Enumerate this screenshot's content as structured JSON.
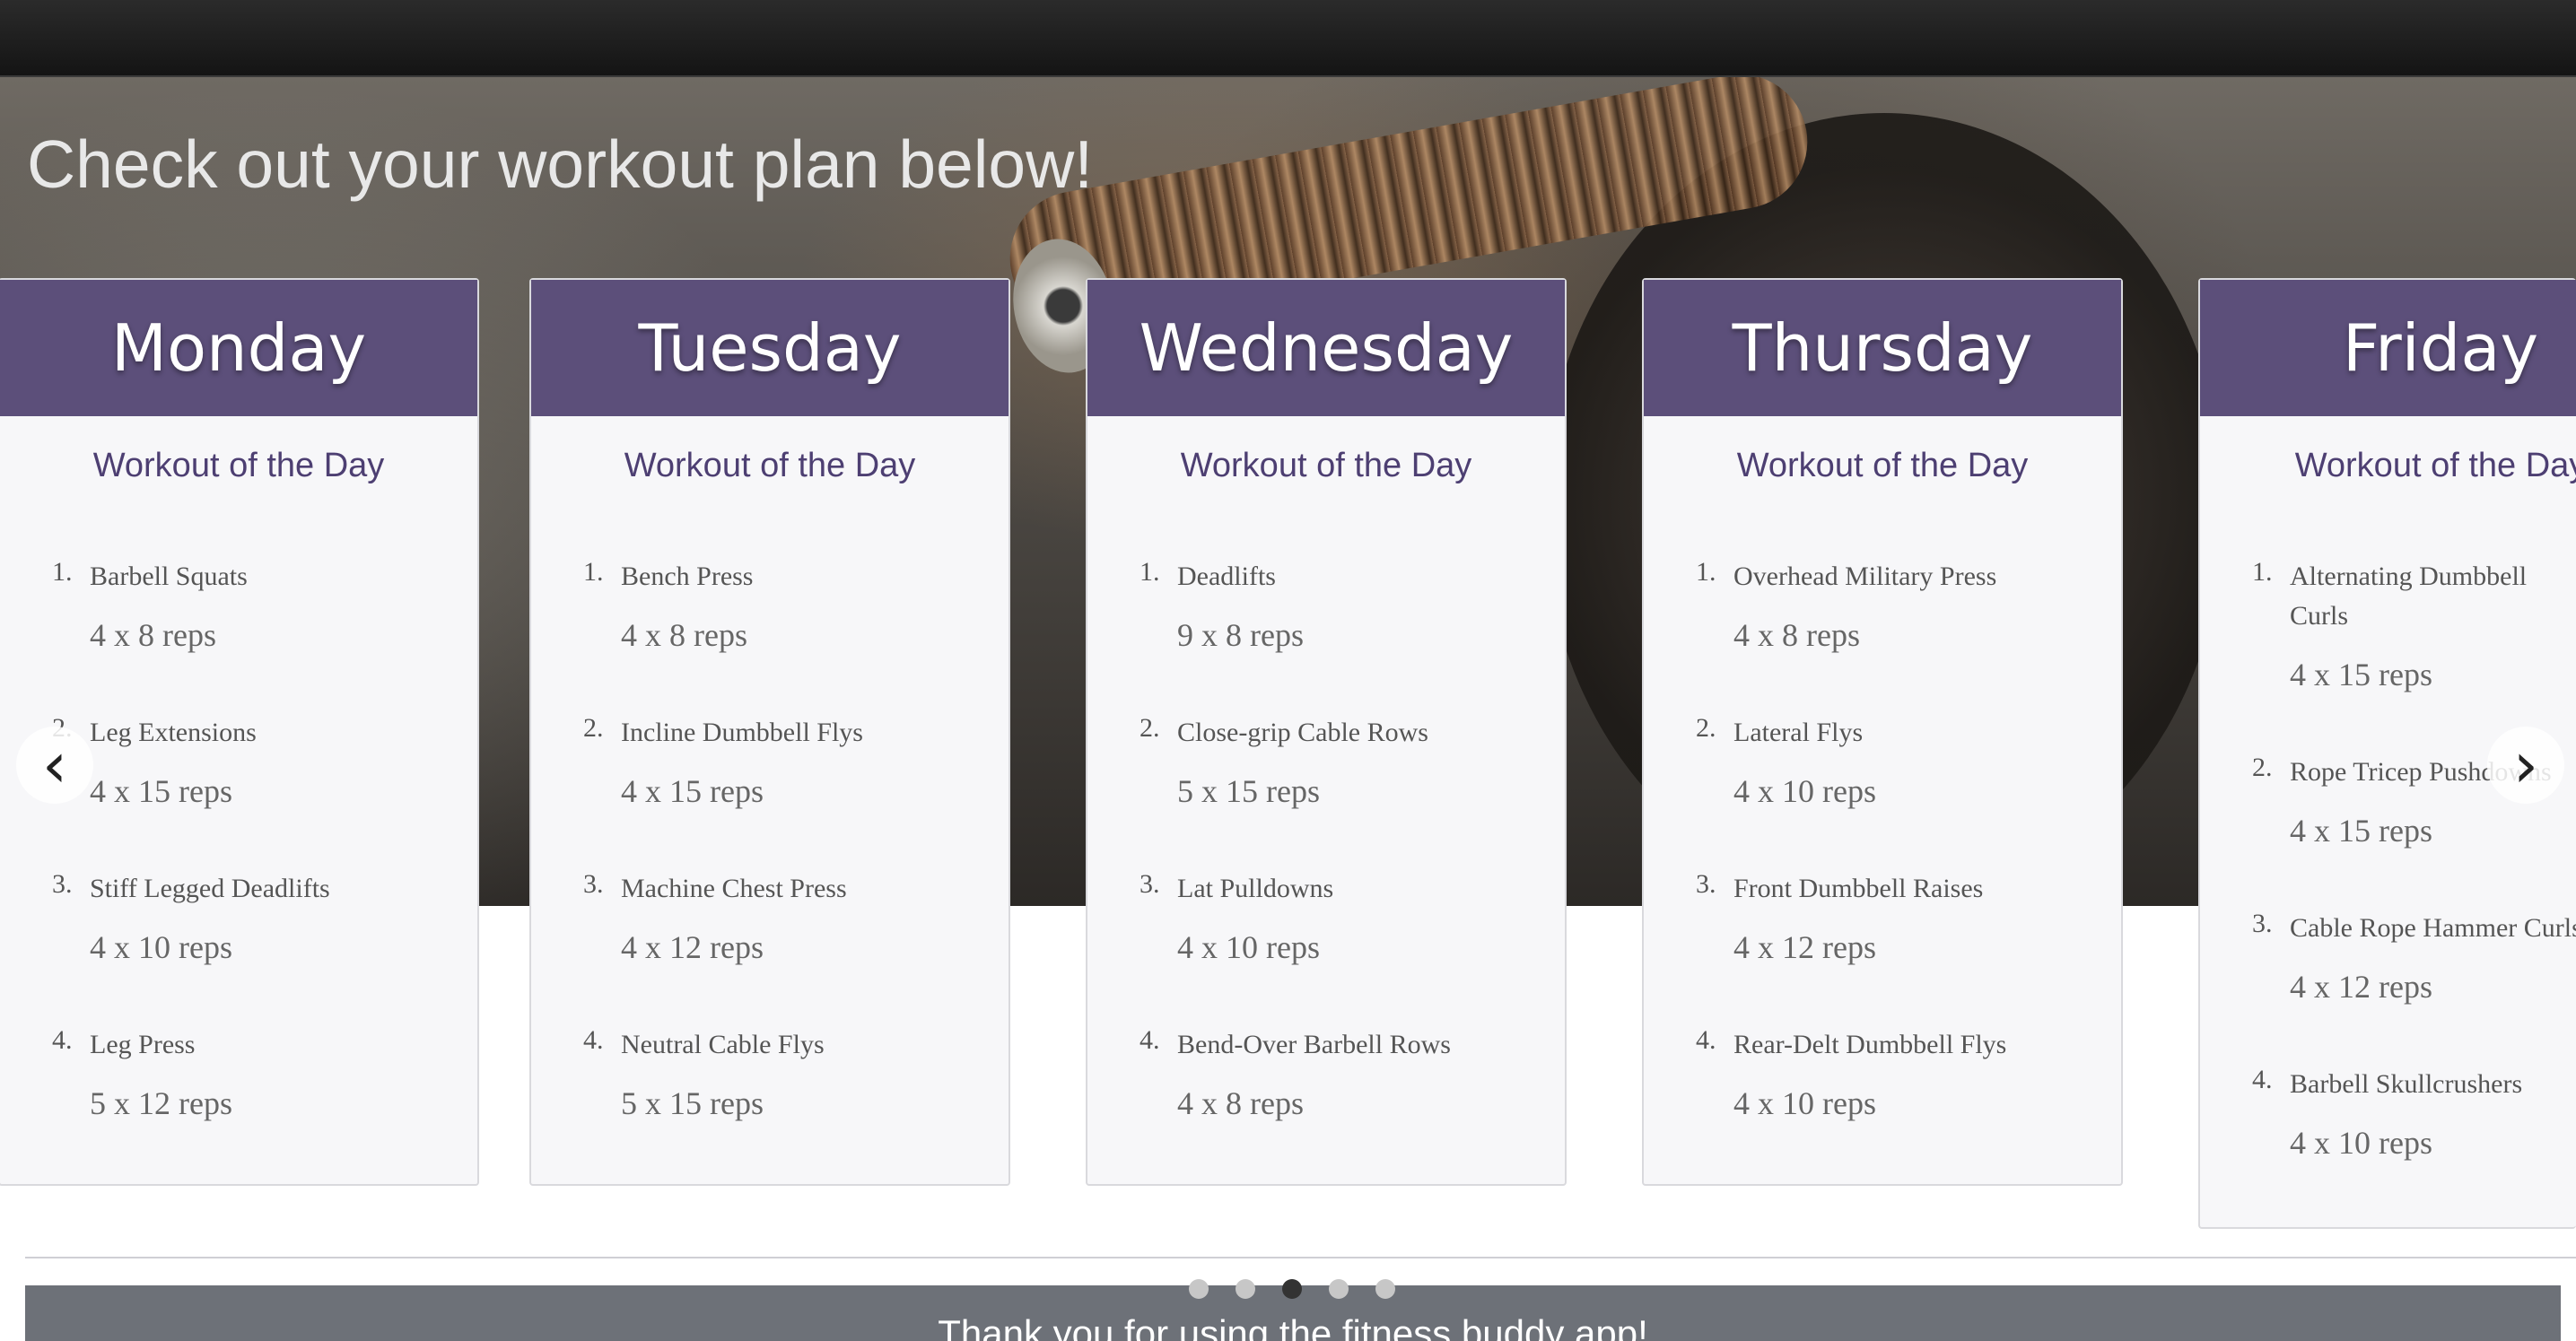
{
  "hero": {
    "title": "Check out your workout plan below!"
  },
  "cards": [
    {
      "day": "Monday",
      "subtitle": "Workout of the Day",
      "exercises": [
        {
          "num": "1.",
          "name": "Barbell Squats",
          "reps": "4 x 8 reps"
        },
        {
          "num": "2.",
          "name": "Leg Extensions",
          "reps": "4 x 15 reps"
        },
        {
          "num": "3.",
          "name": "Stiff Legged Deadlifts",
          "reps": "4 x 10 reps"
        },
        {
          "num": "4.",
          "name": "Leg Press",
          "reps": "5 x 12 reps"
        }
      ]
    },
    {
      "day": "Tuesday",
      "subtitle": "Workout of the Day",
      "exercises": [
        {
          "num": "1.",
          "name": "Bench Press",
          "reps": "4 x 8 reps"
        },
        {
          "num": "2.",
          "name": "Incline Dumbbell Flys",
          "reps": "4 x 15 reps"
        },
        {
          "num": "3.",
          "name": "Machine Chest Press",
          "reps": "4 x 12 reps"
        },
        {
          "num": "4.",
          "name": "Neutral Cable Flys",
          "reps": "5 x 15 reps"
        }
      ]
    },
    {
      "day": "Wednesday",
      "subtitle": "Workout of the Day",
      "exercises": [
        {
          "num": "1.",
          "name": "Deadlifts",
          "reps": "9 x 8 reps"
        },
        {
          "num": "2.",
          "name": "Close-grip Cable Rows",
          "reps": "5 x 15 reps"
        },
        {
          "num": "3.",
          "name": "Lat Pulldowns",
          "reps": "4 x 10 reps"
        },
        {
          "num": "4.",
          "name": "Bend-Over Barbell Rows",
          "reps": "4 x 8 reps"
        }
      ]
    },
    {
      "day": "Thursday",
      "subtitle": "Workout of the Day",
      "exercises": [
        {
          "num": "1.",
          "name": "Overhead Military Press",
          "reps": "4 x 8 reps"
        },
        {
          "num": "2.",
          "name": "Lateral Flys",
          "reps": "4 x 10 reps"
        },
        {
          "num": "3.",
          "name": "Front Dumbbell Raises",
          "reps": "4 x 12 reps"
        },
        {
          "num": "4.",
          "name": "Rear-Delt Dumbbell Flys",
          "reps": "4 x 10 reps"
        }
      ]
    },
    {
      "day": "Friday",
      "subtitle": "Workout of the Day",
      "exercises": [
        {
          "num": "1.",
          "name": "Alternating Dumbbell Curls",
          "reps": "4 x 15 reps"
        },
        {
          "num": "2.",
          "name": "Rope Tricep Pushdowns",
          "reps": "4 x 15 reps"
        },
        {
          "num": "3.",
          "name": "Cable Rope Hammer Curls",
          "reps": "4 x 12 reps"
        },
        {
          "num": "4.",
          "name": "Barbell Skullcrushers",
          "reps": "4 x 10 reps"
        }
      ]
    }
  ],
  "carousel": {
    "prev_icon": "‹",
    "next_icon": "›",
    "dot_count": 5,
    "active_dot": 3
  },
  "footer": {
    "text": "Thank you for using the fitness buddy app!"
  },
  "colors": {
    "card_header": "#5c4f7a",
    "subtitle": "#4d3f72",
    "footer": "#6d7178"
  }
}
